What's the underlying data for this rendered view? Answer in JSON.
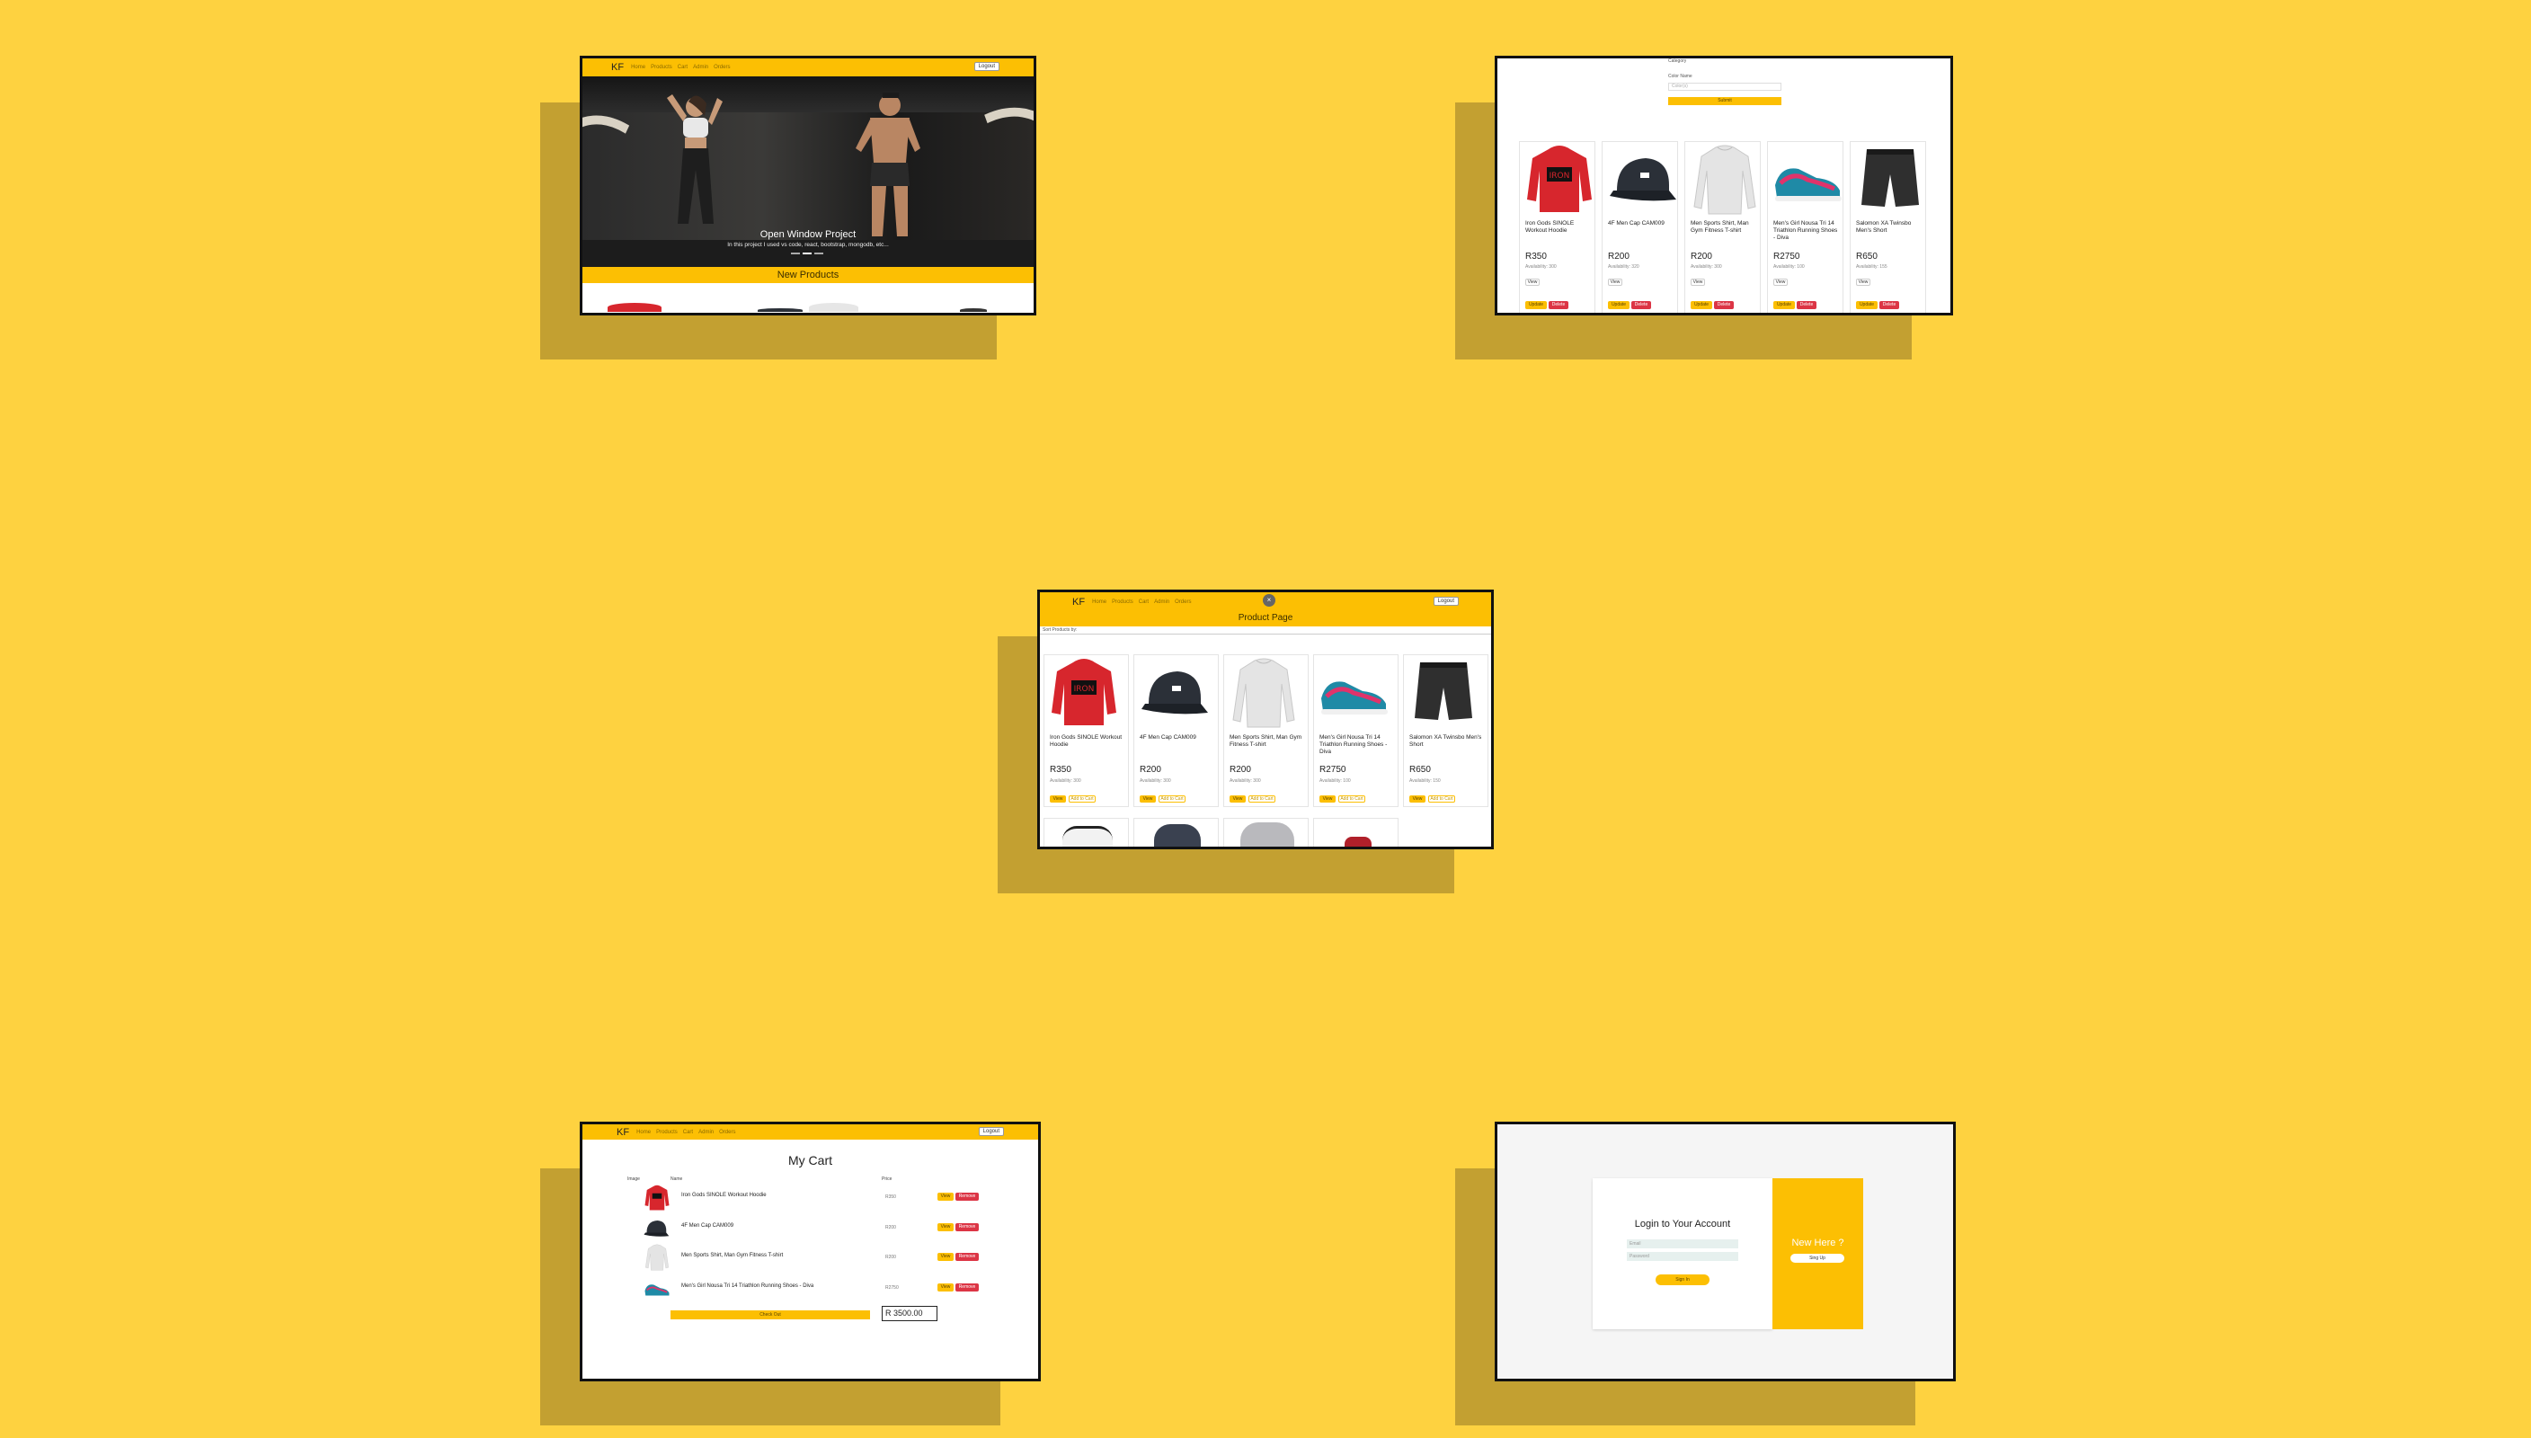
{
  "nav": {
    "logo": "KF",
    "links": [
      "Home",
      "Products",
      "Cart",
      "Admin",
      "Orders"
    ],
    "logout": "Logout"
  },
  "home": {
    "hero_title": "Open Window Project",
    "hero_subtitle": "In this project I used vs code, react, bootstrap, mongodb, etc...",
    "new_products": "New Products"
  },
  "admin": {
    "label_category": "Category",
    "label_color": "Color Name",
    "color_placeholder": "Color(s)",
    "submit": "Submit",
    "update": "Update",
    "delete": "Delete",
    "view": "View"
  },
  "products": [
    {
      "name": "Iron Gods SINOLE Workout Hoodie",
      "price": "R350",
      "avail_admin": "Availability: 300",
      "avail_page": "Availability: 300"
    },
    {
      "name": "4F Men Cap CAM009",
      "price": "R200",
      "avail_admin": "Availability: 320",
      "avail_page": "Availability: 300"
    },
    {
      "name": "Men Sports Shirt, Man Gym Fitness T-shirt",
      "price": "R200",
      "avail_admin": "Availability: 300",
      "avail_page": "Availability: 300"
    },
    {
      "name": "Men's Girl Nousa Tri 14 Triathlon Running Shoes - Diva",
      "price": "R2750",
      "avail_admin": "Availability: 100",
      "avail_page": "Availability: 100"
    },
    {
      "name": "Salomon XA Twinsbo Men's Short",
      "price": "R650",
      "avail_admin": "Availability: 155",
      "avail_page": "Availability: 150"
    }
  ],
  "product_page": {
    "title": "Product Page",
    "sort_label": "Sort Products by:",
    "close": "×",
    "view": "View",
    "add_to_cart": "Add to Cart"
  },
  "cart": {
    "title": "My Cart",
    "headers": [
      "Image",
      "Name",
      "Price"
    ],
    "items": [
      {
        "name": "Iron Gods SINOLE Workout Hoodie",
        "price": "R350"
      },
      {
        "name": "4F Men Cap CAM009",
        "price": "R200"
      },
      {
        "name": "Men Sports Shirt, Man Gym Fitness T-shirt",
        "price": "R200"
      },
      {
        "name": "Men's Girl Nousa Tri 14 Triathlon Running Shoes - Diva",
        "price": "R2750"
      }
    ],
    "view": "View",
    "remove": "Remove",
    "checkout": "Check Out",
    "total": "R 3500.00"
  },
  "login": {
    "title": "Login to Your Account",
    "email_placeholder": "Email",
    "password_placeholder": "Password",
    "sign_in": "Sign In",
    "new_here": "New Here ?",
    "sign_up": "Sing Up"
  },
  "colors": {
    "background": "#fed240",
    "accent": "#fcbf03",
    "danger": "#dc3545",
    "shadow": "#c3a031"
  }
}
